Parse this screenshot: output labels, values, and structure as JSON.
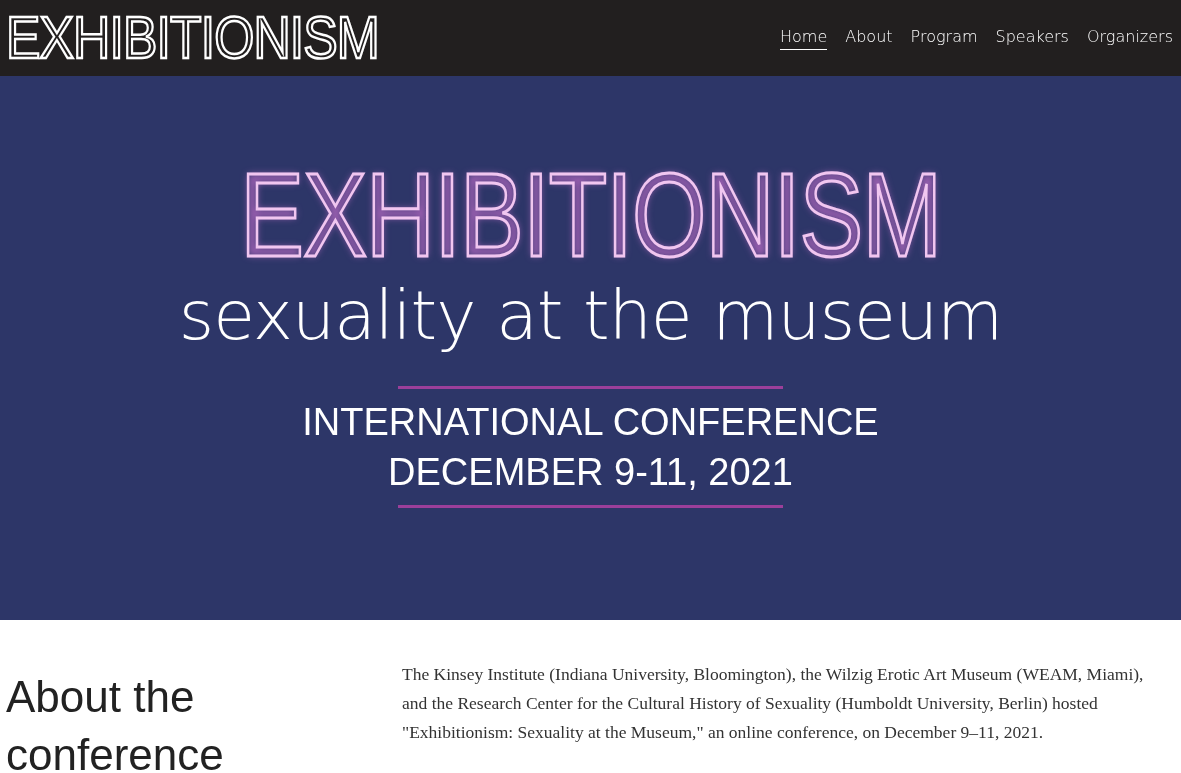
{
  "header": {
    "logo": "EXHIBITIONISM",
    "nav": [
      {
        "label": "Home",
        "selected": true
      },
      {
        "label": "About",
        "selected": false
      },
      {
        "label": "Program",
        "selected": false
      },
      {
        "label": "Speakers",
        "selected": false
      },
      {
        "label": "Organizers",
        "selected": false
      }
    ]
  },
  "banner": {
    "title": "EXHIBITIONISM",
    "subtitle": "sexuality at the museum",
    "lines": [
      "INTERNATIONAL CONFERENCE",
      "DECEMBER 9-11, 2021"
    ]
  },
  "about": {
    "heading": "About the conference",
    "text": "The Kinsey Institute (Indiana University, Bloomington), the Wilzig Erotic Art Museum (WEAM, Miami), and the Research Center for the Cultural History of Sexuality (Humboldt University, Berlin) hosted \"Exhibitionism: Sexuality at the Museum,\" an online conference, on December 9–11, 2021."
  }
}
